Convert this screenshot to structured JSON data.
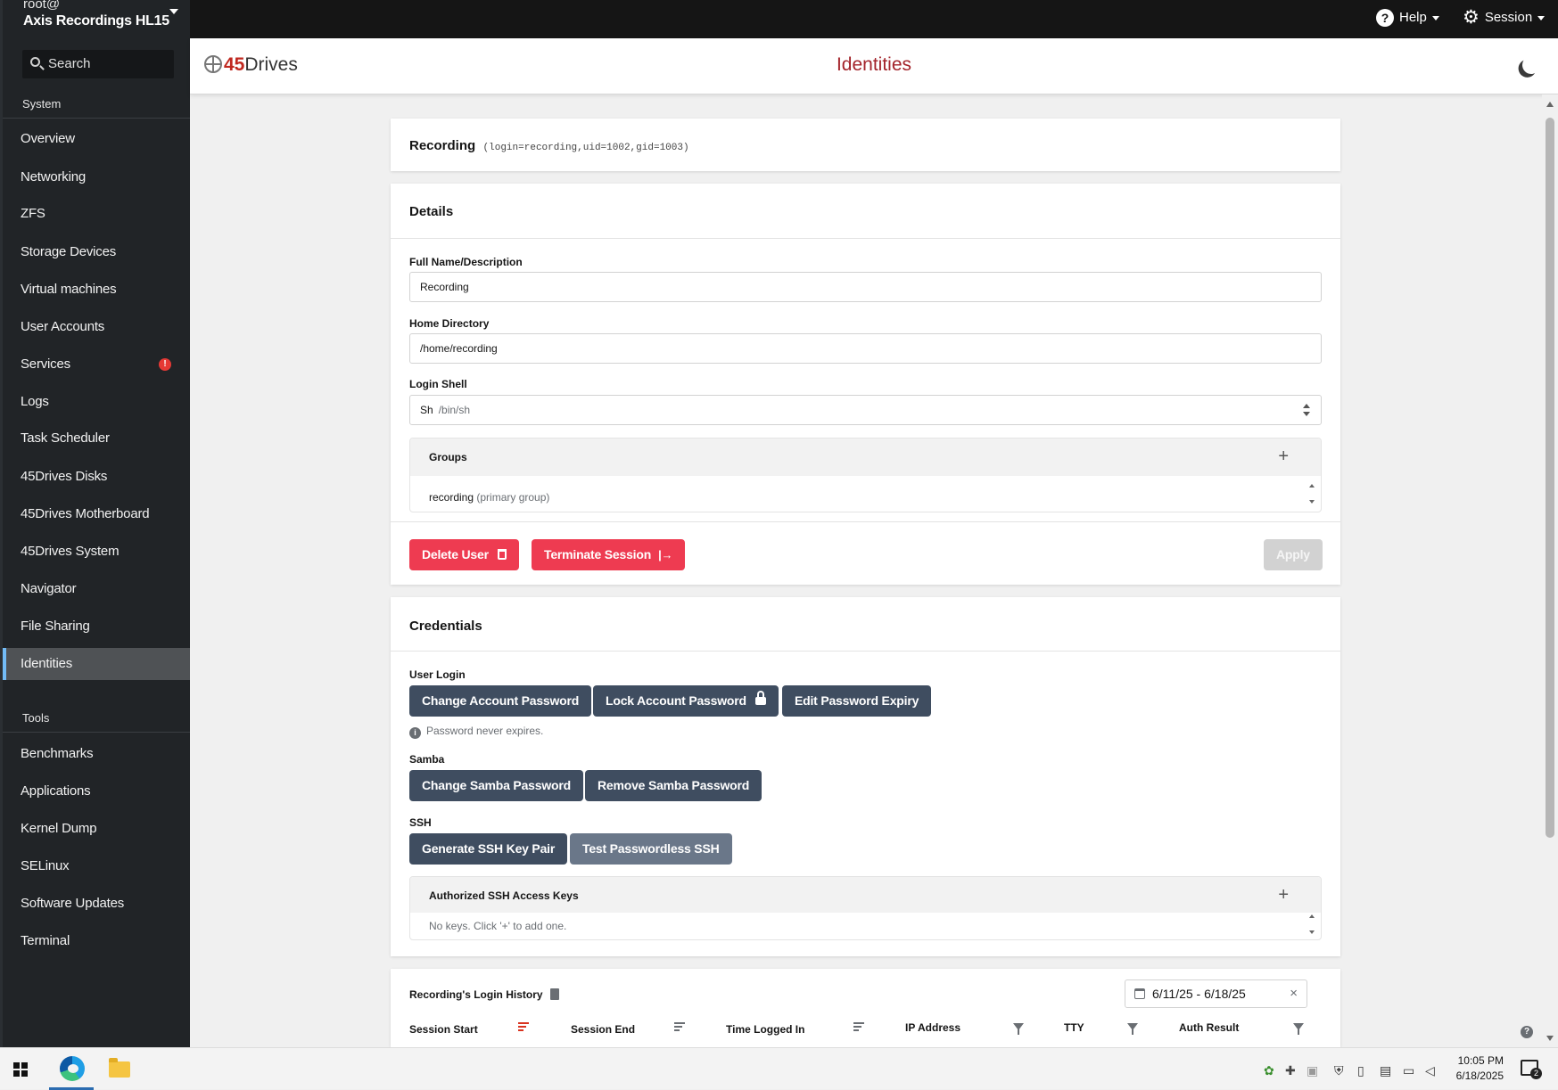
{
  "host": {
    "user": "root@",
    "name": "Axis Recordings HL15"
  },
  "search": {
    "label": "Search"
  },
  "sidebar": {
    "system_label": "System",
    "tools_label": "Tools",
    "system_items": [
      {
        "label": "Overview"
      },
      {
        "label": "Networking"
      },
      {
        "label": "ZFS"
      },
      {
        "label": "Storage Devices"
      },
      {
        "label": "Virtual machines"
      },
      {
        "label": "User Accounts"
      },
      {
        "label": "Services",
        "badge": "!"
      },
      {
        "label": "Logs"
      },
      {
        "label": "Task Scheduler"
      },
      {
        "label": "45Drives Disks"
      },
      {
        "label": "45Drives Motherboard"
      },
      {
        "label": "45Drives System"
      },
      {
        "label": "Navigator"
      },
      {
        "label": "File Sharing"
      },
      {
        "label": "Identities",
        "active": true
      }
    ],
    "tool_items": [
      {
        "label": "Benchmarks"
      },
      {
        "label": "Applications"
      },
      {
        "label": "Kernel Dump"
      },
      {
        "label": "SELinux"
      },
      {
        "label": "Software Updates"
      },
      {
        "label": "Terminal"
      }
    ]
  },
  "topbar": {
    "help_label": "Help",
    "session_label": "Session"
  },
  "header": {
    "brand_num": "45",
    "brand_text": "Drives",
    "title": "Identities"
  },
  "user": {
    "name": "Recording",
    "meta": "(login=recording,uid=1002,gid=1003)"
  },
  "details": {
    "title": "Details",
    "full_name_label": "Full Name/Description",
    "full_name_value": "Recording",
    "home_label": "Home Directory",
    "home_value": "/home/recording",
    "shell_label": "Login Shell",
    "shell_value": "Sh",
    "shell_path": "/bin/sh",
    "groups_label": "Groups",
    "group_name": "recording",
    "group_note": "(primary group)",
    "delete_label": "Delete User",
    "terminate_label": "Terminate Session",
    "terminate_icon": "|→",
    "apply_label": "Apply"
  },
  "credentials": {
    "title": "Credentials",
    "user_login_label": "User Login",
    "change_password_label": "Change Account Password",
    "lock_password_label": "Lock Account Password",
    "edit_expiry_label": "Edit Password Expiry",
    "expiry_note": "Password never expires.",
    "samba_label": "Samba",
    "change_samba_label": "Change Samba Password",
    "remove_samba_label": "Remove Samba Password",
    "ssh_label": "SSH",
    "generate_ssh_label": "Generate SSH Key Pair",
    "test_ssh_label": "Test Passwordless SSH",
    "keys_label": "Authorized SSH Access Keys",
    "keys_empty": "No keys. Click '+' to add one."
  },
  "history": {
    "title": "Recording's Login History",
    "date_range": "6/11/25 - 6/18/25",
    "columns": [
      "Session Start",
      "Session End",
      "Time Logged In",
      "IP Address",
      "TTY",
      "Auth Result"
    ]
  },
  "taskbar": {
    "time": "10:05 PM",
    "date": "6/18/2025",
    "notif_count": "2"
  },
  "colors": {
    "danger": "#ee3b51",
    "dark_button": "#3f4d60",
    "title_red": "#a3232a",
    "active_nav": "#4f5255"
  }
}
